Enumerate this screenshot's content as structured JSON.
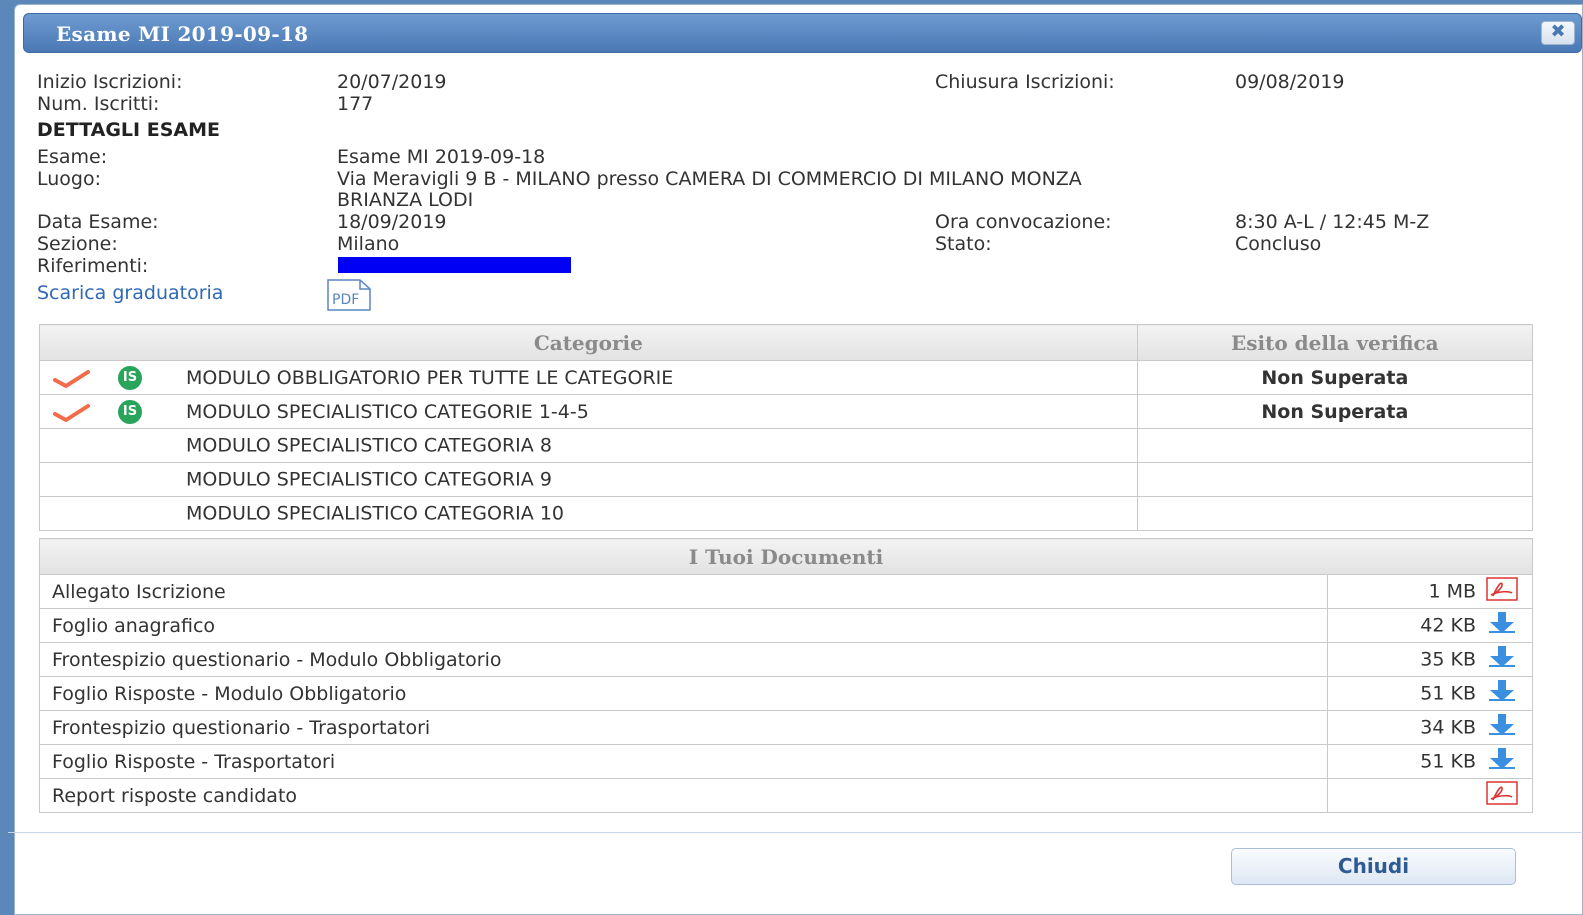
{
  "dialog": {
    "title": "Esame MI 2019-09-18",
    "close_label": "✖"
  },
  "info": {
    "inizio_label": "Inizio Iscrizioni:",
    "inizio_value": "20/07/2019",
    "chiusura_label": "Chiusura Iscrizioni:",
    "chiusura_value": "09/08/2019",
    "iscritti_label": "Num. Iscritti:",
    "iscritti_value": "177",
    "dettagli_heading": "DETTAGLI ESAME",
    "esame_label": "Esame:",
    "esame_value": "Esame MI 2019-09-18",
    "luogo_label": "Luogo:",
    "luogo_value_line1": "Via Meravigli 9 B - MILANO presso CAMERA DI COMMERCIO DI MILANO MONZA",
    "luogo_value_line2": "BRIANZA LODI",
    "data_label": "Data Esame:",
    "data_value": "18/09/2019",
    "ora_label": "Ora convocazione:",
    "ora_value": "8:30 A-L / 12:45 M-Z",
    "sezione_label": "Sezione:",
    "sezione_value": "Milano",
    "stato_label": "Stato:",
    "stato_value": "Concluso",
    "riferimenti_label": "Riferimenti:",
    "download_link": "Scarica graduatoria",
    "pdf_icon_text": "PDF"
  },
  "categorie": {
    "header_categorie": "Categorie",
    "header_esito": "Esito della verifica",
    "rows": [
      {
        "name": "MODULO OBBLIGATORIO PER TUTTE LE CATEGORIE",
        "esito": "Non Superata",
        "icons": true
      },
      {
        "name": "MODULO SPECIALISTICO CATEGORIE 1-4-5",
        "esito": "Non Superata",
        "icons": true
      },
      {
        "name": "MODULO SPECIALISTICO CATEGORIA 8",
        "esito": "",
        "icons": false
      },
      {
        "name": "MODULO SPECIALISTICO CATEGORIA 9",
        "esito": "",
        "icons": false
      },
      {
        "name": "MODULO SPECIALISTICO CATEGORIA 10",
        "esito": "",
        "icons": false
      }
    ],
    "is_icon_text": "IS"
  },
  "documenti": {
    "header": "I Tuoi Documenti",
    "rows": [
      {
        "name": "Allegato Iscrizione",
        "size": "1 MB",
        "icon": "pdf-icon"
      },
      {
        "name": "Foglio anagrafico",
        "size": "42 KB",
        "icon": "download-arrow-icon"
      },
      {
        "name": "Frontespizio questionario - Modulo Obbligatorio",
        "size": "35 KB",
        "icon": "download-arrow-icon"
      },
      {
        "name": "Foglio Risposte - Modulo Obbligatorio",
        "size": "51 KB",
        "icon": "download-arrow-icon"
      },
      {
        "name": "Frontespizio questionario - Trasportatori",
        "size": "34 KB",
        "icon": "download-arrow-icon"
      },
      {
        "name": "Foglio Risposte - Trasportatori",
        "size": "51 KB",
        "icon": "download-arrow-icon"
      },
      {
        "name": "Report risposte candidato",
        "size": "",
        "icon": "pdf-icon"
      }
    ]
  },
  "footer": {
    "close_button": "Chiudi"
  },
  "colors": {
    "title_bar": "#4a78b4",
    "error_red": "#ef0000",
    "is_green": "#28a55a",
    "link_blue": "#2f68b5",
    "redaction": "#0000f5"
  }
}
